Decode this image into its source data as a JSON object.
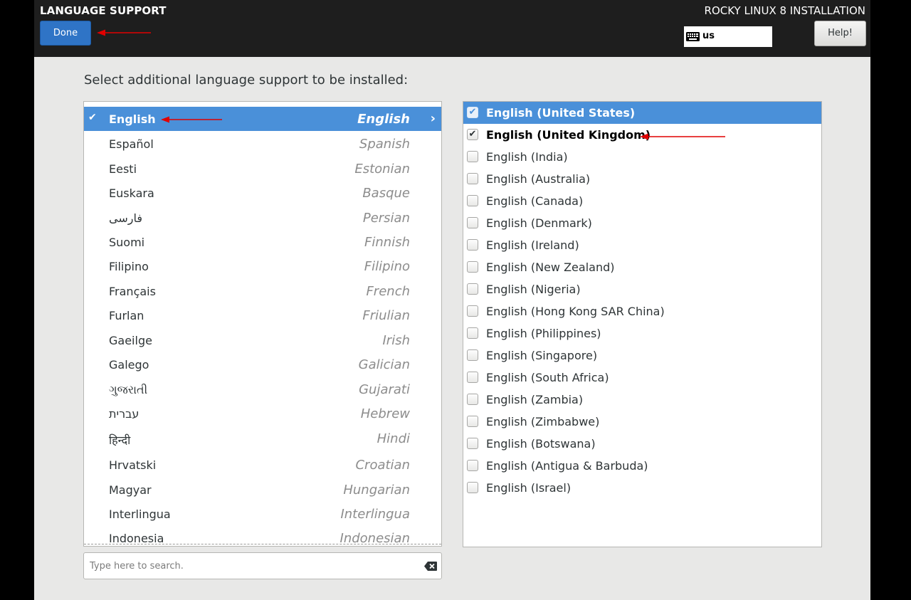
{
  "header": {
    "spoke_title": "LANGUAGE SUPPORT",
    "done_label": "Done",
    "product_title": "ROCKY LINUX 8 INSTALLATION",
    "keyboard_layout": "us",
    "keyboard_icon": "keyboard-icon",
    "help_label": "Help!"
  },
  "prompt": "Select additional language support to be installed:",
  "languages": [
    {
      "native": "English",
      "english": "English",
      "selected": true
    },
    {
      "native": "Español",
      "english": "Spanish"
    },
    {
      "native": "Eesti",
      "english": "Estonian"
    },
    {
      "native": "Euskara",
      "english": "Basque"
    },
    {
      "native": "فارسی",
      "english": "Persian"
    },
    {
      "native": "Suomi",
      "english": "Finnish"
    },
    {
      "native": "Filipino",
      "english": "Filipino"
    },
    {
      "native": "Français",
      "english": "French"
    },
    {
      "native": "Furlan",
      "english": "Friulian"
    },
    {
      "native": "Gaeilge",
      "english": "Irish"
    },
    {
      "native": "Galego",
      "english": "Galician"
    },
    {
      "native": "ગુજરાતી",
      "english": "Gujarati"
    },
    {
      "native": "עברית",
      "english": "Hebrew"
    },
    {
      "native": "हिन्दी",
      "english": "Hindi"
    },
    {
      "native": "Hrvatski",
      "english": "Croatian"
    },
    {
      "native": "Magyar",
      "english": "Hungarian"
    },
    {
      "native": "Interlingua",
      "english": "Interlingua"
    },
    {
      "native": "Indonesia",
      "english": "Indonesian"
    }
  ],
  "search": {
    "placeholder": "Type here to search.",
    "clear_icon": "clear-icon"
  },
  "locales": [
    {
      "label": "English (United States)",
      "checked": true,
      "highlighted": true
    },
    {
      "label": "English (United Kingdom)",
      "checked": true
    },
    {
      "label": "English (India)",
      "checked": false
    },
    {
      "label": "English (Australia)",
      "checked": false
    },
    {
      "label": "English (Canada)",
      "checked": false
    },
    {
      "label": "English (Denmark)",
      "checked": false
    },
    {
      "label": "English (Ireland)",
      "checked": false
    },
    {
      "label": "English (New Zealand)",
      "checked": false
    },
    {
      "label": "English (Nigeria)",
      "checked": false
    },
    {
      "label": "English (Hong Kong SAR China)",
      "checked": false
    },
    {
      "label": "English (Philippines)",
      "checked": false
    },
    {
      "label": "English (Singapore)",
      "checked": false
    },
    {
      "label": "English (South Africa)",
      "checked": false
    },
    {
      "label": "English (Zambia)",
      "checked": false
    },
    {
      "label": "English (Zimbabwe)",
      "checked": false
    },
    {
      "label": "English (Botswana)",
      "checked": false
    },
    {
      "label": "English (Antigua & Barbuda)",
      "checked": false
    },
    {
      "label": "English (Israel)",
      "checked": false
    }
  ],
  "colors": {
    "selection": "#4a90d9",
    "done_button": "#2f74c6",
    "annotation_arrow": "#e00000"
  }
}
